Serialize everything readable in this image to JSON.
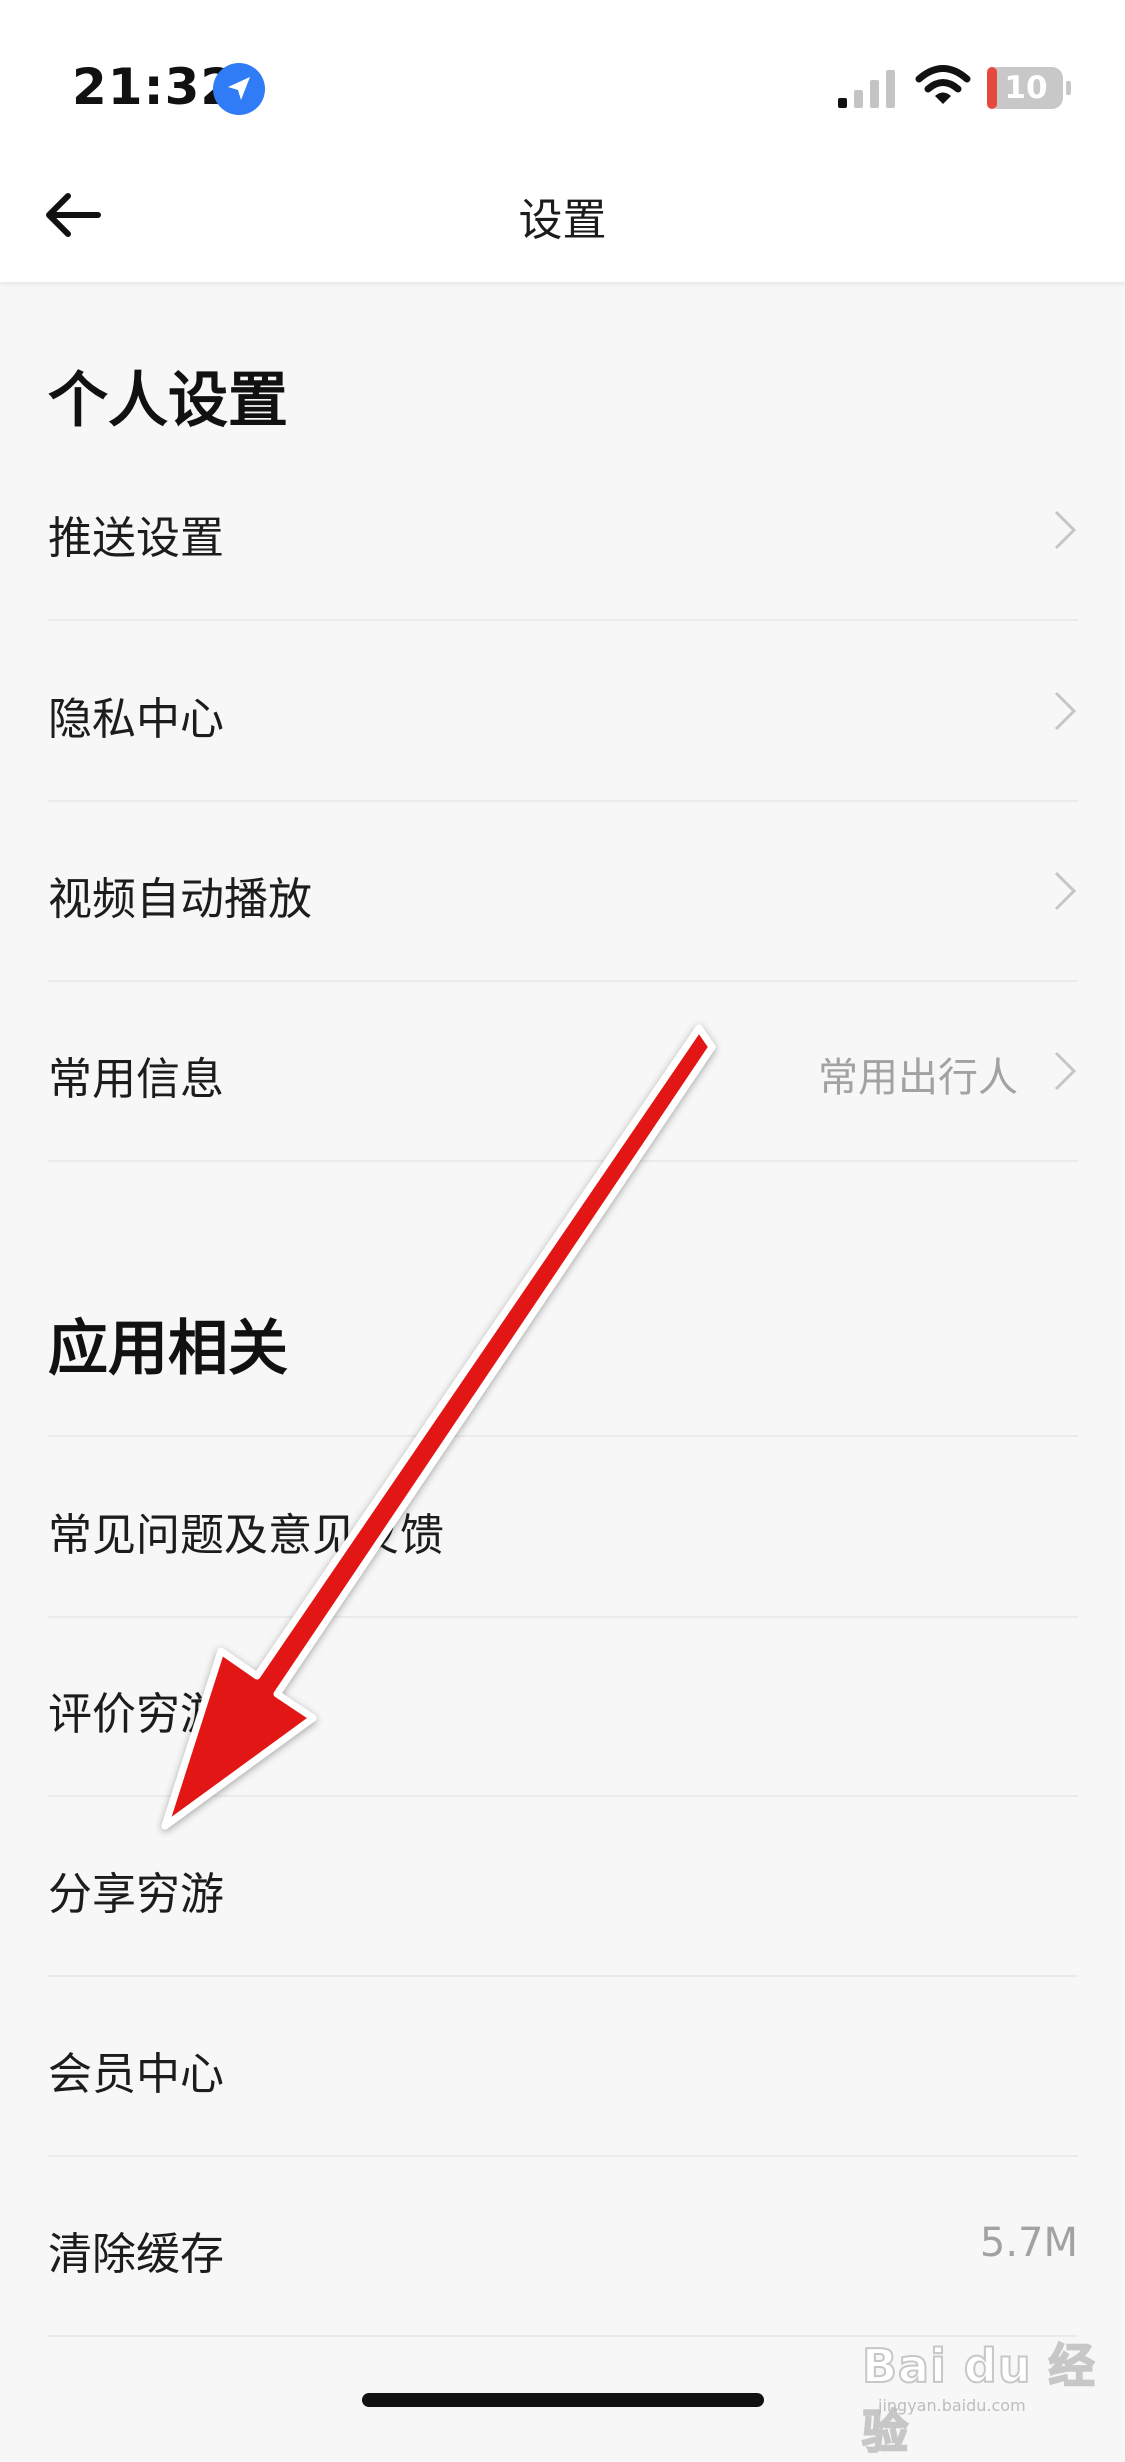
{
  "status_bar": {
    "time": "21:32",
    "battery": "10",
    "battery_color": "#e5483d",
    "icons": [
      "location-arrow-icon",
      "cellular-signal-icon",
      "wifi-icon",
      "battery-icon"
    ]
  },
  "nav": {
    "title": "设置",
    "back_icon": "back-arrow-icon"
  },
  "sections": {
    "personal": {
      "title": "个人设置",
      "items": [
        {
          "label": "推送设置"
        },
        {
          "label": "隐私中心"
        },
        {
          "label": "视频自动播放"
        },
        {
          "label": "常用信息",
          "value": "常用出行人"
        }
      ]
    },
    "app": {
      "title": "应用相关",
      "items": [
        {
          "label": "常见问题及意见反馈"
        },
        {
          "label": "评价穷游"
        },
        {
          "label": "分享穷游"
        },
        {
          "label": "会员中心"
        },
        {
          "label": "清除缓存",
          "value": "5.7M"
        }
      ]
    }
  },
  "annotation": {
    "arrow_color": "#e31414"
  },
  "watermark": {
    "text": "Bai du 经验",
    "sub": "jingyan.baidu.com"
  },
  "colors": {
    "accent_blue": "#2f7cf6",
    "divider": "#ebebeb",
    "secondary_text": "#a2a2a2"
  }
}
